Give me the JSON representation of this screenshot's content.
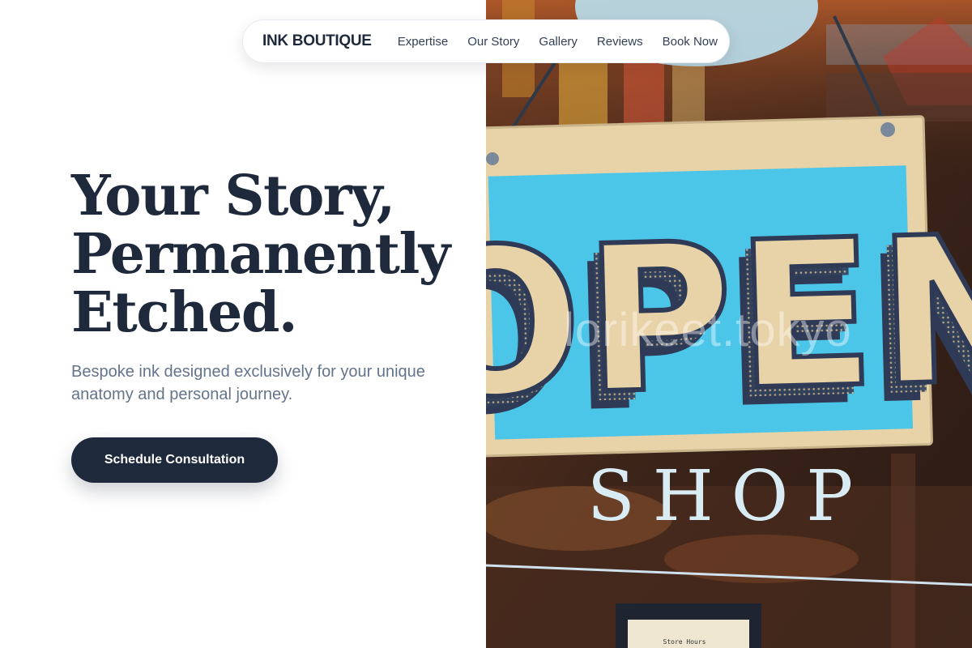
{
  "nav": {
    "brand": "INK BOUTIQUE",
    "links": [
      "Expertise",
      "Our Story",
      "Gallery",
      "Reviews",
      "Book Now"
    ]
  },
  "hero": {
    "headline_lines": [
      "Your Story,",
      "Permanently",
      "Etched."
    ],
    "subtitle": "Bespoke ink designed exclusively for your unique anatomy and personal journey.",
    "cta_label": "Schedule Consultation"
  },
  "photo": {
    "sign_text": "OPEN",
    "window_text": "SHOP",
    "watermark": "lorikeet.tokyo",
    "card_text": "Store Hours"
  },
  "colors": {
    "primary": "#1e293b",
    "muted_text": "#64748b",
    "sign_blue": "#4cc6e8",
    "sign_tan": "#e8d2a8"
  }
}
